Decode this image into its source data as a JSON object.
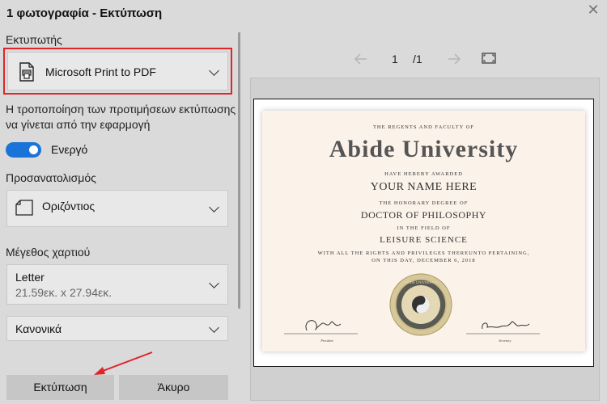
{
  "window": {
    "title": "1 φωτογραφία - Εκτύπωση",
    "close_glyph": "✕"
  },
  "printer": {
    "label": "Εκτυπωτής",
    "selected": "Microsoft Print to PDF",
    "icon": "printer-icon"
  },
  "preferences": {
    "text": "Η τροποποίηση των προτιμήσεων εκτύπωσης να γίνεται από την εφαρμογή",
    "toggle_label": "Ενεργό",
    "toggle_on": true
  },
  "orientation": {
    "label": "Προσανατολισμός",
    "selected": "Οριζόντιος",
    "icon": "page-icon"
  },
  "paper_size": {
    "label": "Μέγεθος χαρτιού",
    "selected": "Letter",
    "dimensions": "21.59εκ. x 27.94εκ."
  },
  "quality": {
    "selected": "Κανονικά"
  },
  "buttons": {
    "print": "Εκτύπωση",
    "cancel": "Άκυρο"
  },
  "preview": {
    "page": "1",
    "separator": "/",
    "total": "1",
    "certificate": {
      "line1": "THE REGENTS AND FACULTY OF",
      "university": "Abide University",
      "line2": "HAVE HEREBY AWARDED",
      "name": "YOUR NAME HERE",
      "line3": "THE HONORARY DEGREE OF",
      "degree": "DOCTOR OF PHILOSOPHY",
      "line4": "IN THE FIELD OF",
      "field": "LEISURE SCIENCE",
      "line5": "WITH ALL THE RIGHTS AND PRIVILEGES THEREUNTO PERTAINING,",
      "line6": "ON THIS DAY, DECEMBER 6, 2018",
      "seal_text": "ABIDE UNIVERSITY",
      "sig_left_label": "President",
      "sig_right_label": "Secretary"
    }
  },
  "colors": {
    "accent": "#1a73d8",
    "highlight": "#e0242a",
    "background": "#dadada"
  }
}
